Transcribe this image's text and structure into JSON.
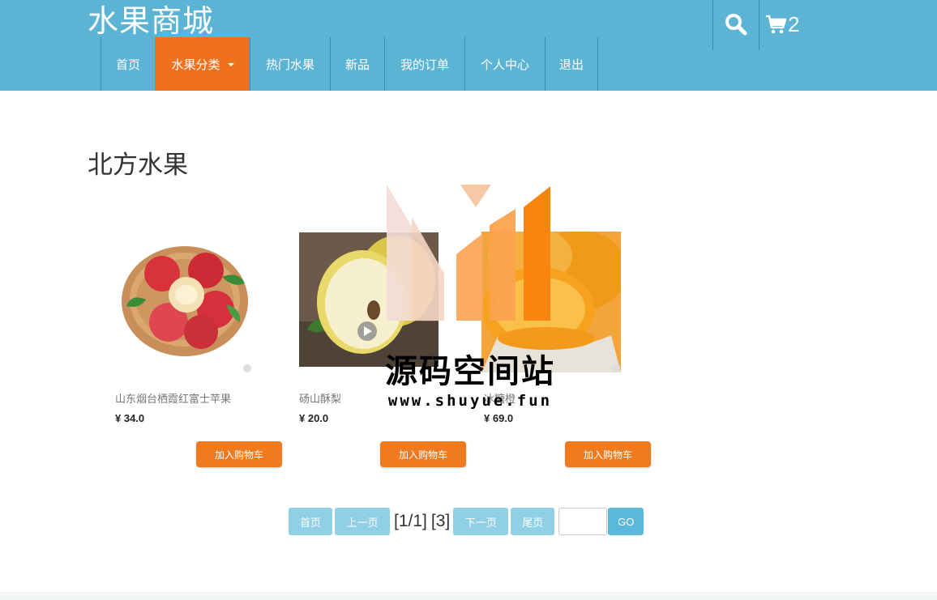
{
  "header": {
    "brand": "水果商城",
    "cart_count": "2",
    "colors": {
      "header_bg": "#5bb4d4",
      "active_nav_bg": "#f0711d"
    },
    "icons": {
      "search": "search-icon",
      "cart": "cart-icon"
    }
  },
  "nav": {
    "items": [
      {
        "label": "首页"
      },
      {
        "label": "水果分类"
      },
      {
        "label": "热门水果"
      },
      {
        "label": "新品"
      },
      {
        "label": "我的订单"
      },
      {
        "label": "个人中心"
      },
      {
        "label": "退出"
      }
    ]
  },
  "category": {
    "title": "北方水果"
  },
  "products": [
    {
      "name": "山东烟台栖霞红富士苹果",
      "price": "¥ 34.0",
      "button": "加入购物车"
    },
    {
      "name": "砀山酥梨",
      "price": "¥ 20.0",
      "button": "加入购物车"
    },
    {
      "name": "冰糖橙",
      "price": "¥ 69.0",
      "button": "加入购物车"
    }
  ],
  "pagination": {
    "first": "首页",
    "prev": "上一页",
    "page_info": "[1/1]",
    "total": "[3]",
    "next": "下一页",
    "last": "尾页",
    "go": "GO",
    "input_value": ""
  },
  "watermark": {
    "text": "源码空间站",
    "url": "www.shuyue.fun"
  }
}
